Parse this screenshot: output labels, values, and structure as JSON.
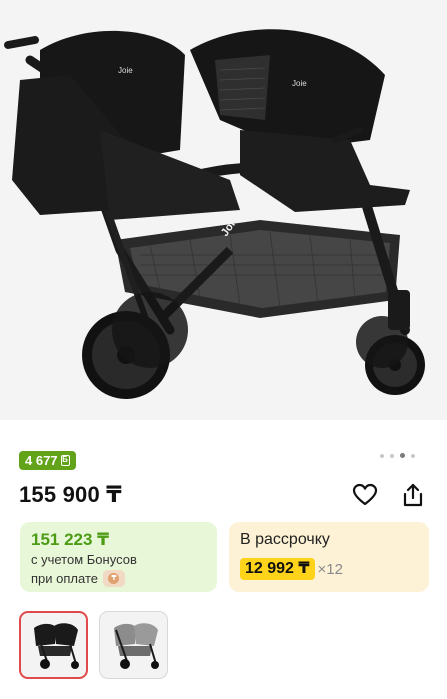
{
  "product": {
    "image_alt": "Joie",
    "brand_on_product": "Joie",
    "bonus_badge": "4 677",
    "bonus_badge_icon": "bonus-b-icon",
    "price": "155 900 ₸",
    "favorite_icon": "heart-icon",
    "share_icon": "share-icon"
  },
  "carousel": {
    "total": 4,
    "active": 2
  },
  "bonus_card": {
    "price": "151 223 ₸",
    "note_line1": "с учетом Бонусов",
    "note_line2": "при оплате",
    "payment_icon": "kaspi-pay-icon"
  },
  "installment_card": {
    "title": "В рассрочку",
    "amount": "12 992 ₸",
    "multiplier": "×12"
  },
  "thumbnails": [
    {
      "name": "black-stroller",
      "selected": true
    },
    {
      "name": "grey-stroller",
      "selected": false
    }
  ],
  "colors": {
    "badge_green": "#62a31a",
    "bonus_bg": "#e8f7d8",
    "bonus_text": "#4c9c15",
    "install_bg": "#fdf2d6",
    "install_highlight": "#ffd31a",
    "selected_border": "#e14a4a"
  }
}
